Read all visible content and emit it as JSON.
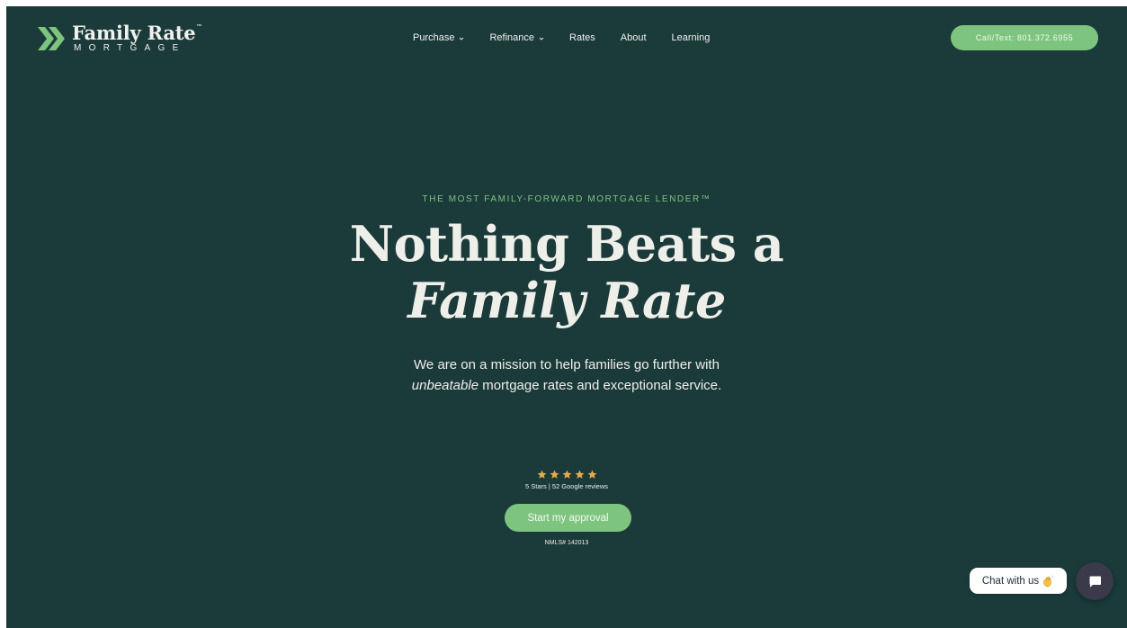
{
  "header": {
    "logo": {
      "main": "Family Rate",
      "tm": "™",
      "sub": "MORTGAGE"
    },
    "nav": [
      {
        "label": "Purchase",
        "has_dropdown": true
      },
      {
        "label": "Refinance",
        "has_dropdown": true
      },
      {
        "label": "Rates",
        "has_dropdown": false
      },
      {
        "label": "About",
        "has_dropdown": false
      },
      {
        "label": "Learning",
        "has_dropdown": false
      }
    ],
    "call_button": "Call/Text: 801.372.6955"
  },
  "hero": {
    "eyebrow": "THE MOST FAMILY-FORWARD MORTGAGE LENDER™",
    "headline_line1": "Nothing Beats a",
    "headline_line2": "Family Rate",
    "subcopy_line1": "We are on a mission to help families go further with",
    "subcopy_emphasis": "unbeatable",
    "subcopy_line2_rest": " mortgage rates and exceptional service.",
    "rating": 5,
    "rating_max": 5,
    "reviews_text": "5 Stars | 52 Google reviews",
    "cta_label": "Start my approval",
    "nmls": "NMLS# 142013"
  },
  "chat": {
    "bubble_label": "Chat with us",
    "wave_icon": "waving-hand-icon",
    "launcher_icon": "chat-icon"
  },
  "colors": {
    "background": "#1b3a3a",
    "accent_green": "#7dc47f",
    "star_gold": "#e8a94a",
    "text_light": "#efefea",
    "chat_launcher": "#3a3a4a"
  }
}
